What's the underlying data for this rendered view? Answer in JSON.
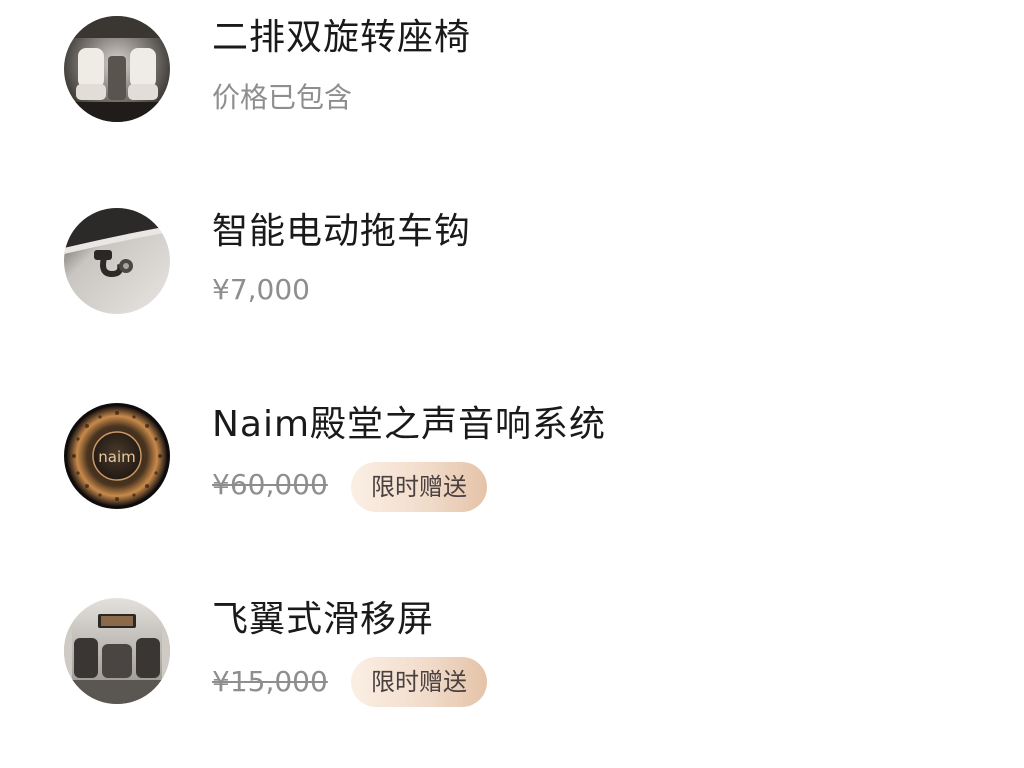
{
  "items": [
    {
      "title": "二排双旋转座椅",
      "price": "价格已包含",
      "thumb_icon": "rotating-seat-photo"
    },
    {
      "title": "智能电动拖车钩",
      "price": "¥7,000",
      "thumb_icon": "tow-hook-photo"
    },
    {
      "title": "Naim殿堂之声音响系统",
      "price": "¥60,000",
      "badge": "限时赠送",
      "thumb_icon": "naim-speaker-photo",
      "thumb_logo": "naim"
    },
    {
      "title": "飞翼式滑移屏",
      "price": "¥15,000",
      "badge": "限时赠送",
      "thumb_icon": "sliding-screen-photo"
    }
  ],
  "colors": {
    "title": "#1a1a1a",
    "price": "#8e8e8e",
    "badge_start": "#fbefe4",
    "badge_end": "#e5c3a8"
  }
}
